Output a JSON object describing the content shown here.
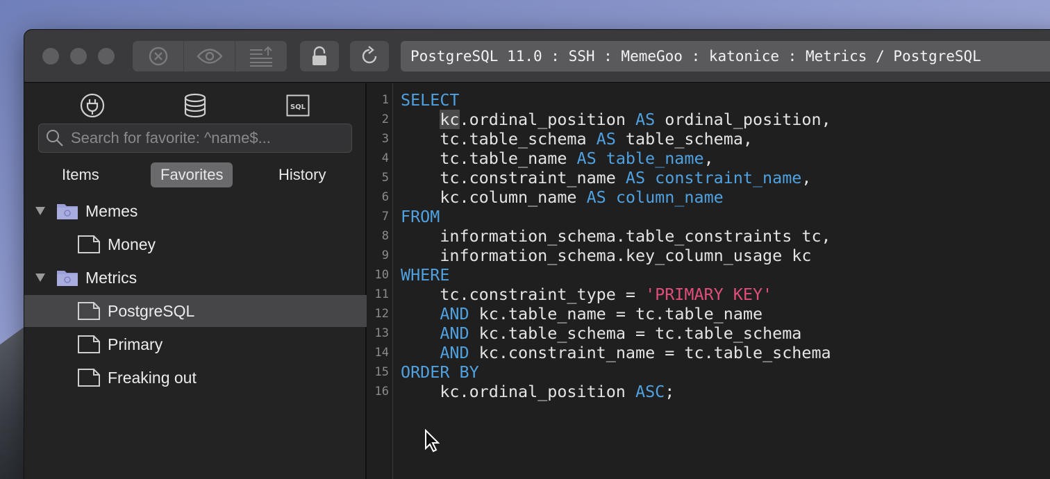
{
  "window": {
    "address": "PostgreSQL 11.0 : SSH : MemeGoo : katonice : Metrics / PostgreSQL"
  },
  "toolbar": {
    "buttons": [
      "close-circle-icon",
      "eye-icon",
      "text-lines-icon",
      "lock-icon",
      "refresh-icon"
    ]
  },
  "sidebar": {
    "search_placeholder": "Search for favorite: ^name$...",
    "tabs": [
      {
        "label": "Items"
      },
      {
        "label": "Favorites",
        "active": true
      },
      {
        "label": "History"
      }
    ],
    "tree": [
      {
        "type": "folder",
        "label": "Memes"
      },
      {
        "type": "file",
        "label": "Money"
      },
      {
        "type": "folder",
        "label": "Metrics"
      },
      {
        "type": "file",
        "label": "PostgreSQL",
        "selected": true
      },
      {
        "type": "file",
        "label": "Primary"
      },
      {
        "type": "file",
        "label": "Freaking out"
      }
    ]
  },
  "editor": {
    "line_numbers": [
      "1",
      "2",
      "3",
      "4",
      "5",
      "6",
      "7",
      "8",
      "9",
      "10",
      "11",
      "12",
      "13",
      "14",
      "15",
      "16"
    ],
    "lines": [
      [
        {
          "t": "SELECT",
          "c": "kw"
        }
      ],
      [
        {
          "t": "    "
        },
        {
          "t": "kc",
          "c": "hl"
        },
        {
          "t": ".ordinal_position "
        },
        {
          "t": "AS",
          "c": "kw"
        },
        {
          "t": " ordinal_position,"
        }
      ],
      [
        {
          "t": "    tc.table_schema "
        },
        {
          "t": "AS",
          "c": "kw"
        },
        {
          "t": " table_schema,"
        }
      ],
      [
        {
          "t": "    tc.table_name "
        },
        {
          "t": "AS table_name",
          "c": "kw"
        },
        {
          "t": ","
        }
      ],
      [
        {
          "t": "    tc.constraint_name "
        },
        {
          "t": "AS constraint_name",
          "c": "kw"
        },
        {
          "t": ","
        }
      ],
      [
        {
          "t": "    kc.column_name "
        },
        {
          "t": "AS column_name",
          "c": "kw"
        }
      ],
      [
        {
          "t": "FROM",
          "c": "kw"
        }
      ],
      [
        {
          "t": "    information_schema.table_constraints tc,"
        }
      ],
      [
        {
          "t": "    information_schema.key_column_usage kc"
        }
      ],
      [
        {
          "t": "WHERE",
          "c": "kw"
        }
      ],
      [
        {
          "t": "    tc.constraint_type = "
        },
        {
          "t": "'PRIMARY KEY'",
          "c": "str"
        }
      ],
      [
        {
          "t": "    "
        },
        {
          "t": "AND",
          "c": "kw"
        },
        {
          "t": " kc.table_name = tc.table_name"
        }
      ],
      [
        {
          "t": "    "
        },
        {
          "t": "AND",
          "c": "kw"
        },
        {
          "t": " kc.table_schema = tc.table_schema"
        }
      ],
      [
        {
          "t": "    "
        },
        {
          "t": "AND",
          "c": "kw"
        },
        {
          "t": " kc.constraint_name = tc.table_schema"
        }
      ],
      [
        {
          "t": "ORDER BY",
          "c": "kw"
        }
      ],
      [
        {
          "t": "    kc.ordinal_position "
        },
        {
          "t": "ASC",
          "c": "kw"
        },
        {
          "t": ";"
        }
      ]
    ]
  },
  "colors": {
    "keyword": "#4fa1e0",
    "string": "#e24e7a",
    "text": "#e4e4e4",
    "folder": "#9b9ed8"
  }
}
